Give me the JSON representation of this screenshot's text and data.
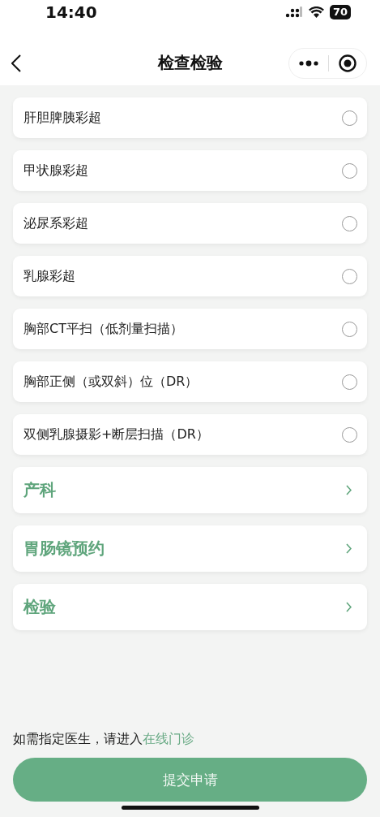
{
  "status_bar": {
    "time": "14:40",
    "battery": "70"
  },
  "nav": {
    "title": "检查检验"
  },
  "options": [
    {
      "label": "肝胆脾胰彩超",
      "selected": false
    },
    {
      "label": "甲状腺彩超",
      "selected": false
    },
    {
      "label": "泌尿系彩超",
      "selected": false
    },
    {
      "label": "乳腺彩超",
      "selected": false
    },
    {
      "label": "胸部CT平扫（低剂量扫描）",
      "selected": false
    },
    {
      "label": "胸部正侧（或双斜）位（DR）",
      "selected": false
    },
    {
      "label": "双侧乳腺摄影+断层扫描（DR）",
      "selected": false
    }
  ],
  "categories": [
    {
      "label": "产科"
    },
    {
      "label": "胃肠镜预约"
    },
    {
      "label": "检验"
    }
  ],
  "hint": {
    "text": "如需指定医生，请进入",
    "link": "在线门诊"
  },
  "submit_button": "提交申请"
}
